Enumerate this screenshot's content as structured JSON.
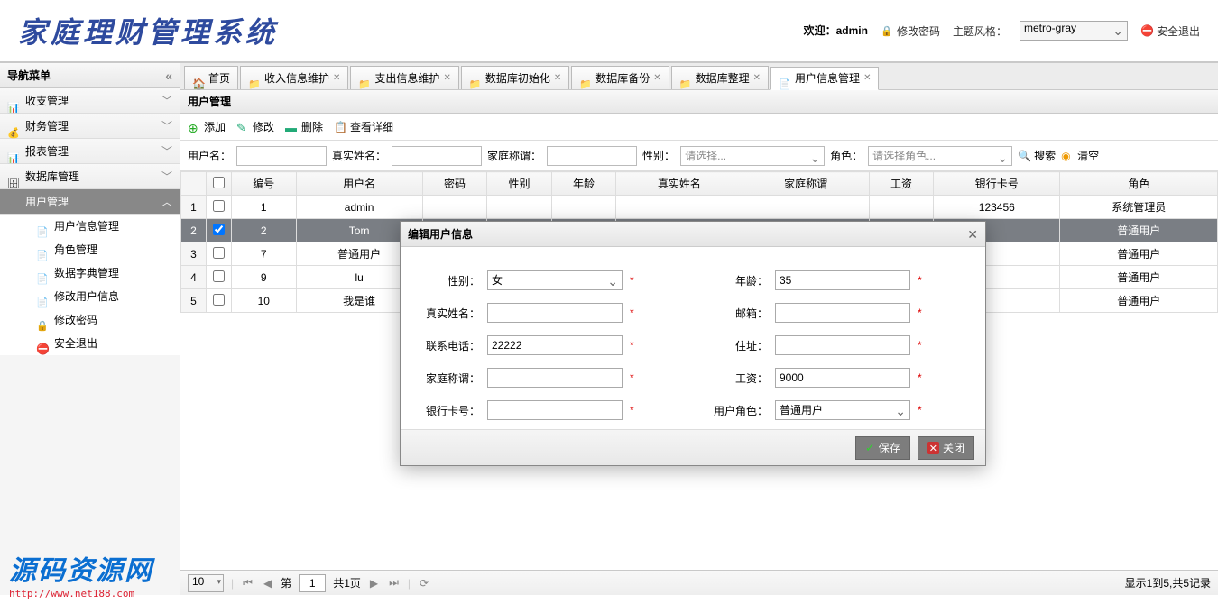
{
  "header": {
    "logo": "家庭理财管理系统",
    "welcome_label": "欢迎：",
    "welcome_user": "admin",
    "change_pwd": "修改密码",
    "theme_label": "主题风格：",
    "theme_value": "metro-gray",
    "logout": "安全退出"
  },
  "sidebar": {
    "title": "导航菜单",
    "items": [
      {
        "label": "收支管理",
        "icon": "chart"
      },
      {
        "label": "财务管理",
        "icon": "money"
      },
      {
        "label": "报表管理",
        "icon": "chart"
      },
      {
        "label": "数据库管理",
        "icon": "db"
      },
      {
        "label": "用户管理",
        "icon": "gear",
        "active": true
      }
    ],
    "subitems": [
      {
        "label": "用户信息管理",
        "icon": "doc"
      },
      {
        "label": "角色管理",
        "icon": "doc"
      },
      {
        "label": "数据字典管理",
        "icon": "doc"
      },
      {
        "label": "修改用户信息",
        "icon": "doc"
      },
      {
        "label": "修改密码",
        "icon": "lock"
      },
      {
        "label": "安全退出",
        "icon": "exit"
      }
    ]
  },
  "tabs": [
    {
      "label": "首页",
      "icon": "home",
      "closable": false
    },
    {
      "label": "收入信息维护",
      "icon": "folder"
    },
    {
      "label": "支出信息维护",
      "icon": "folder"
    },
    {
      "label": "数据库初始化",
      "icon": "folder"
    },
    {
      "label": "数据库备份",
      "icon": "folder"
    },
    {
      "label": "数据库整理",
      "icon": "folder"
    },
    {
      "label": "用户信息管理",
      "icon": "doc",
      "active": true
    }
  ],
  "panel_title": "用户管理",
  "toolbar": {
    "add": "添加",
    "edit": "修改",
    "del": "删除",
    "view": "查看详细"
  },
  "search": {
    "username_label": "用户名：",
    "realname_label": "真实姓名：",
    "family_label": "家庭称谓：",
    "gender_label": "性别：",
    "gender_placeholder": "请选择...",
    "role_label": "角色：",
    "role_placeholder": "请选择角色...",
    "search_btn": "搜索",
    "clear_btn": "清空"
  },
  "table": {
    "headers": [
      "编号",
      "用户名",
      "密码",
      "性别",
      "年龄",
      "真实姓名",
      "家庭称谓",
      "工资",
      "银行卡号",
      "角色"
    ],
    "rows": [
      {
        "n": 1,
        "id": "1",
        "user": "admin",
        "pwd": "",
        "gender": "",
        "age": "",
        "name": "",
        "family": "",
        "salary": "",
        "bank": "123456",
        "role": "系统管理员"
      },
      {
        "n": 2,
        "id": "2",
        "user": "Tom",
        "pwd": "",
        "gender": "",
        "age": "",
        "name": "",
        "family": "",
        "salary": "",
        "bank": "",
        "role": "普通用户",
        "selected": true,
        "checked": true
      },
      {
        "n": 3,
        "id": "7",
        "user": "普通用户",
        "pwd": "",
        "gender": "",
        "age": "",
        "name": "",
        "family": "",
        "salary": "",
        "bank": "",
        "role": "普通用户"
      },
      {
        "n": 4,
        "id": "9",
        "user": "lu",
        "pwd": "",
        "gender": "",
        "age": "",
        "name": "",
        "family": "",
        "salary": "",
        "bank": "",
        "role": "普通用户"
      },
      {
        "n": 5,
        "id": "10",
        "user": "我是谁",
        "pwd": "",
        "gender": "",
        "age": "",
        "name": "",
        "family": "",
        "salary": "",
        "bank": "",
        "role": "普通用户"
      }
    ]
  },
  "pager": {
    "page_size": "10",
    "page_label_prefix": "第",
    "page_no": "1",
    "total_pages": "共1页",
    "info": "显示1到5,共5记录"
  },
  "dialog": {
    "title": "编辑用户信息",
    "gender_label": "性别：",
    "gender_value": "女",
    "age_label": "年龄：",
    "age_value": "35",
    "realname_label": "真实姓名：",
    "realname_value": "",
    "email_label": "邮箱：",
    "email_value": "",
    "phone_label": "联系电话：",
    "phone_value": "22222",
    "address_label": "住址：",
    "address_value": "",
    "family_label": "家庭称谓：",
    "family_value": "",
    "salary_label": "工资：",
    "salary_value": "9000",
    "bank_label": "银行卡号：",
    "bank_value": "",
    "role_label": "用户角色：",
    "role_value": "普通用户",
    "save": "保存",
    "close": "关闭"
  },
  "watermark": {
    "line1": "源码资源网",
    "line2": "http://www.net188.com"
  }
}
